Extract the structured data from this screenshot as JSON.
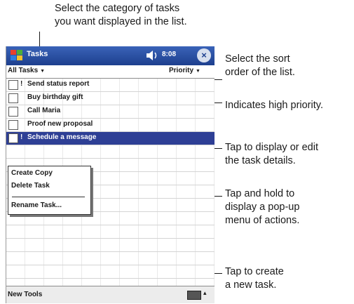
{
  "callouts": {
    "category": "Select the category of tasks\nyou want displayed in the list.",
    "sort": "Select the sort\norder of the list.",
    "high_priority": "Indicates high priority.",
    "task_details": "Tap to display or edit\nthe task details.",
    "popup_menu": "Tap and hold to\ndisplay a pop-up\nmenu of actions.",
    "new_task": "Tap to create\na new task."
  },
  "titlebar": {
    "title": "Tasks",
    "start_icon": "windows-flag-icon",
    "volume_icon": "speaker-icon",
    "clock": "8:08",
    "close_label": "×"
  },
  "filterbar": {
    "category": "All Tasks",
    "sort": "Priority",
    "dropdown_icon": "triangle-down-icon"
  },
  "tasks": [
    {
      "priority": "!",
      "text": "Send status report"
    },
    {
      "priority": "",
      "text": "Buy birthday gift"
    },
    {
      "priority": "",
      "text": "Call Maria"
    },
    {
      "priority": "",
      "text": "Proof new proposal"
    },
    {
      "priority": "!",
      "text": "Schedule a message"
    }
  ],
  "popup": {
    "items": [
      "Create Copy",
      "Delete Task",
      "Rename Task..."
    ]
  },
  "menubar": {
    "new_label": "New  Tools",
    "keyboard_icon": "keyboard-icon",
    "keyboard_arrow": "▴"
  },
  "colors": {
    "titlebar": "#1d3f8e",
    "selection": "#2e3f95"
  }
}
